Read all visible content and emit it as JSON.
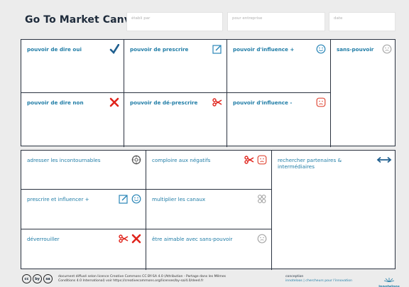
{
  "header": {
    "title": "Go To Market Canvas",
    "fields": [
      "établi par",
      "pour entreprise",
      "date"
    ]
  },
  "top_grid": {
    "cells": [
      {
        "label": "pouvoir de dire oui",
        "icon": "checkmark-icon"
      },
      {
        "label": "pouvoir de prescrire",
        "icon": "pencil-square-icon"
      },
      {
        "label": "pouvoir d'influence +",
        "icon": "smiley-happy-icon"
      },
      {
        "label": "sans-pouvoir",
        "icon": "smiley-neutral-icon"
      },
      {
        "label": "pouvoir de dire non",
        "icon": "cross-icon"
      },
      {
        "label": "pouvoir de dé-prescrire",
        "icon": "scissors-icon"
      },
      {
        "label": "pouvoir d'influence -",
        "icon": "smiley-sad-icon"
      }
    ]
  },
  "bottom_grid": {
    "cells": [
      {
        "label": "adresser les incontournables",
        "icons": [
          "target-icon"
        ]
      },
      {
        "label": "comploire aux négatifs",
        "icons": [
          "scissors-icon",
          "smiley-sad-icon"
        ]
      },
      {
        "label": "rechercher partenaires & intermédiaires",
        "icons": [
          "double-arrow-icon"
        ]
      },
      {
        "label": "prescrire et influencer +",
        "icons": [
          "pencil-square-icon",
          "smiley-happy-icon"
        ]
      },
      {
        "label": "multiplier les canaux",
        "icons": [
          "chain-link-icon"
        ]
      },
      {
        "label": "déverrouiller",
        "icons": [
          "scissors-icon",
          "cross-icon"
        ]
      },
      {
        "label": "être aimable avec sans-pouvoir",
        "icons": [
          "smiley-neutral-icon"
        ]
      }
    ]
  },
  "footer": {
    "license_line1": "document diffusé selon licence Creative Commons CC BY-SA 4.0 (Attribution - Partage dans les Mêmes",
    "license_line2": "Conditions 4.0 International) voir https://creativecommons.org/licenses/by-sa/4.0/deed.fr",
    "conception_label": "conception",
    "conception_value": "innoteloos | chercheurs pour l'innovation",
    "logo_text": "innoteloos",
    "cc_icons": [
      "cc",
      "by",
      "sa"
    ]
  },
  "colors": {
    "label_blue": "#1f7ca6",
    "check_blue": "#1f5f8f",
    "cross_red": "#e0241c",
    "smile_blue": "#2a86b7",
    "sad_red": "#e04b3a",
    "neutral_gray": "#a9a9a9"
  }
}
